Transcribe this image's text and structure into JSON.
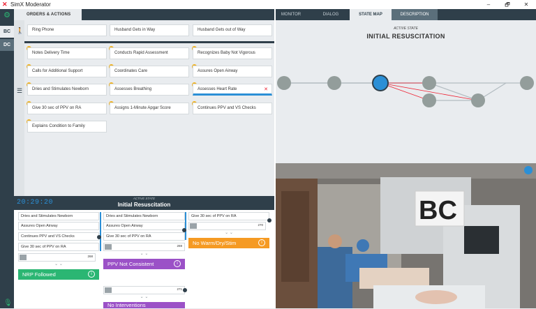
{
  "app": {
    "title": "SimX Moderator"
  },
  "window": {
    "minimize": "–",
    "restore": "🗗",
    "close": "✕"
  },
  "sidebar": {
    "bc_label": "BC",
    "dc_label": "DC"
  },
  "orders": {
    "header": "ORDERS & ACTIONS"
  },
  "right_tabs": [
    {
      "label": "MONITOR"
    },
    {
      "label": "DIALOG"
    },
    {
      "label": "STATE MAP"
    },
    {
      "label": "DESCRIPTION"
    }
  ],
  "action_row1": [
    "Ring Phone",
    "Husband Gets in Way",
    "Husband Gets out of Way"
  ],
  "action_cards": [
    "Notes Delivery Time",
    "Conducts Rapid Assessment",
    "Recognizes Baby Not Vigorous",
    "Calls for Additional Support",
    "Coordinates Care",
    "Assures Open Airway",
    "Dries and Stimulates Newborn",
    "Assesses Breathing",
    "Assesses Heart Rate",
    "Give 30 sec of PPV on RA",
    "Assigns 1-Minute Apgar Score",
    "Continues PPV and VS Checks",
    "Explains Condition to Family"
  ],
  "remove_label": "✕",
  "state_map": {
    "active_label": "ACTIVE STATE",
    "title": "INITIAL RESUSCITATION"
  },
  "timer": {
    "clock": "20:29:20",
    "active_label": "ACTIVE STATE",
    "title": "Initial Resuscitation"
  },
  "tracks": {
    "col1": [
      "Dries and Stimulates Newborn",
      "Assures Open Airway",
      "Continues PPV and VS Checks",
      "Give 30 sec of PPV on RA"
    ],
    "col1_value": "268",
    "col1_outcome": "NRP Followed",
    "col2": [
      "Dries and Stimulates Newborn",
      "Assures Open Airway",
      "Give 30 sec of PPV on RA"
    ],
    "col2_value": "269",
    "col2_outcome": "PPV Not Consistent",
    "col2b_value": "271",
    "col2b_outcome": "No Interventions",
    "col3": [
      "Give 30 sec of PPV on RA"
    ],
    "col3_value": "270",
    "col3_outcome": "No Warm/Dry/Stim"
  },
  "info_glyph": "i",
  "video": {
    "overlay_text": "BC"
  },
  "colors": {
    "dark": "#2f3f4a",
    "accent_blue": "#2b8fd6",
    "green": "#2bb673",
    "purple": "#9b51c7",
    "orange": "#f59a23",
    "badge": "#f0b323",
    "red_path": "#e23"
  }
}
